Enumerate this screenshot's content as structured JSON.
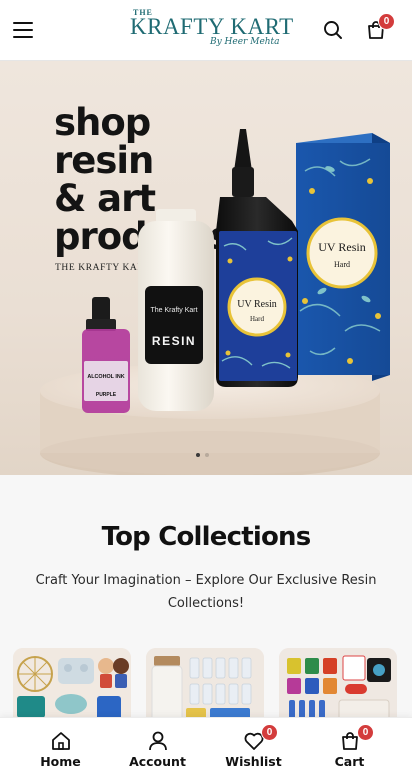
{
  "header": {
    "logo": {
      "the": "THE",
      "name": "KRAFTY KART",
      "byline": "By Heer Mehta"
    },
    "menu_icon": "hamburger-menu-icon",
    "search_icon": "search-icon",
    "cart_icon": "shopping-bag-icon",
    "cart_count": "0"
  },
  "hero": {
    "headline": [
      "shop",
      "resin",
      "& art",
      "products."
    ],
    "brand": "THE KRAFTY KART",
    "products": {
      "ink_label_line1": "ALCOHOL INK",
      "ink_label_line2": "PURPLE",
      "resin_brand": "The Krafty Kart",
      "resin_label": "RESIN",
      "uv_bottle_title": "UV Resin",
      "uv_bottle_sub": "Hard",
      "uv_box_title": "UV Resin",
      "uv_box_sub": "Hard"
    },
    "slides_total": 2,
    "active_slide": 1
  },
  "collections": {
    "title": "Top Collections",
    "subtitle": "Craft Your Imagination – Explore Our Exclusive Resin Collections!"
  },
  "bottom_nav": [
    {
      "label": "Home",
      "icon": "home-icon"
    },
    {
      "label": "Account",
      "icon": "user-icon"
    },
    {
      "label": "Wishlist",
      "icon": "heart-icon",
      "badge": "0"
    },
    {
      "label": "Cart",
      "icon": "shopping-bag-icon",
      "badge": "0"
    }
  ],
  "colors": {
    "brand": "#1f6b73",
    "badge": "#d33c3c",
    "hero_bg": "#ece3da",
    "box_blue": "#1b56a8",
    "bottle_blue": "#1e3f9a",
    "label_yellow": "#e8c338"
  }
}
